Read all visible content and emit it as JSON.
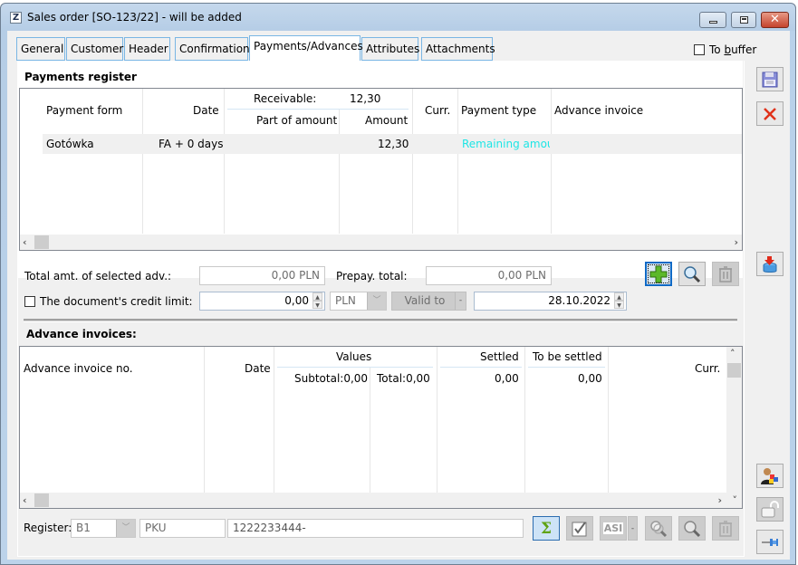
{
  "window": {
    "title": "Sales order [SO-123/22] - will be added",
    "app_icon": "Z",
    "controls": {
      "minimize": "minimize-icon",
      "maximize": "restore-icon",
      "close": "close-icon"
    }
  },
  "tabs": [
    {
      "label": "General",
      "active": false
    },
    {
      "label": "Customer",
      "active": false
    },
    {
      "label": "Header",
      "active": false
    },
    {
      "label": "Confirmation",
      "active": false
    },
    {
      "label": "Payments/Advances",
      "active": true
    },
    {
      "label": "Attributes",
      "active": false
    },
    {
      "label": "Attachments",
      "active": false
    }
  ],
  "to_buffer": {
    "label_pre": "To ",
    "label_hotkey": "b",
    "label_post": "uffer",
    "checked": false
  },
  "payments_register": {
    "title": "Payments register",
    "headers": {
      "payment_form": "Payment form",
      "date": "Date",
      "receivable_label": "Receivable:",
      "receivable_value": "12,30",
      "part_of_amount": "Part of amount",
      "amount": "Amount",
      "currency": "Curr.",
      "payment_type": "Payment type",
      "advance_invoice": "Advance invoice"
    },
    "rows": [
      {
        "payment_form": "Gotówka",
        "date": "FA + 0 days",
        "part_of_amount": "",
        "amount": "12,30",
        "currency": "",
        "payment_type": "Remaining amou",
        "advance_invoice": ""
      }
    ],
    "payment_type_color": "#1ee5e5"
  },
  "form": {
    "total_selected_label": "Total amt. of selected adv.:",
    "total_selected_value": "0,00 PLN",
    "prepay_total_label": "Prepay. total:",
    "prepay_total_value": "0,00 PLN",
    "credit_limit_label": "The document's credit limit:",
    "credit_limit_checked": false,
    "credit_limit_value": "0,00",
    "currency_value": "PLN",
    "valid_to_label": "Valid to",
    "valid_to_date": "28.10.2022"
  },
  "advance_invoices": {
    "title": "Advance invoices:",
    "headers": {
      "number": "Advance invoice no.",
      "date": "Date",
      "values": "Values",
      "subtotal": "Subtotal:0,00",
      "total": "Total:0,00",
      "settled": "Settled",
      "settled_sum": "0,00",
      "to_be_settled": "To be settled",
      "to_be_settled_sum": "0,00",
      "currency": "Curr."
    },
    "rows": []
  },
  "register": {
    "label": "Register:",
    "code": "B1",
    "symbol": "PKU",
    "account": "1222233444-"
  },
  "toolbar_actions": [
    {
      "name": "add-button",
      "icon": "plus-icon"
    },
    {
      "name": "preview-button",
      "icon": "magnifier-icon"
    },
    {
      "name": "delete-button",
      "icon": "trash-icon"
    }
  ],
  "bottom_actions": [
    {
      "name": "sum-button",
      "icon": "sigma-icon"
    },
    {
      "name": "select-all-button",
      "icon": "checkbox-icon"
    },
    {
      "name": "asi-button",
      "icon": "asi-icon"
    },
    {
      "name": "find-button",
      "icon": "magnifier-double-icon"
    },
    {
      "name": "preview-button",
      "icon": "magnifier-icon"
    },
    {
      "name": "delete-button",
      "icon": "trash-icon"
    }
  ],
  "rail_actions": [
    {
      "name": "save-button",
      "icon": "floppy-disk-icon"
    },
    {
      "name": "cancel-button",
      "icon": "red-x-icon"
    },
    {
      "name": "import-button",
      "icon": "bucket-arrow-icon"
    },
    {
      "name": "user-switch-button",
      "icon": "user-swap-icon"
    },
    {
      "name": "unlock-button",
      "icon": "padlock-open-icon"
    },
    {
      "name": "pin-button",
      "icon": "pushpin-icon"
    }
  ]
}
